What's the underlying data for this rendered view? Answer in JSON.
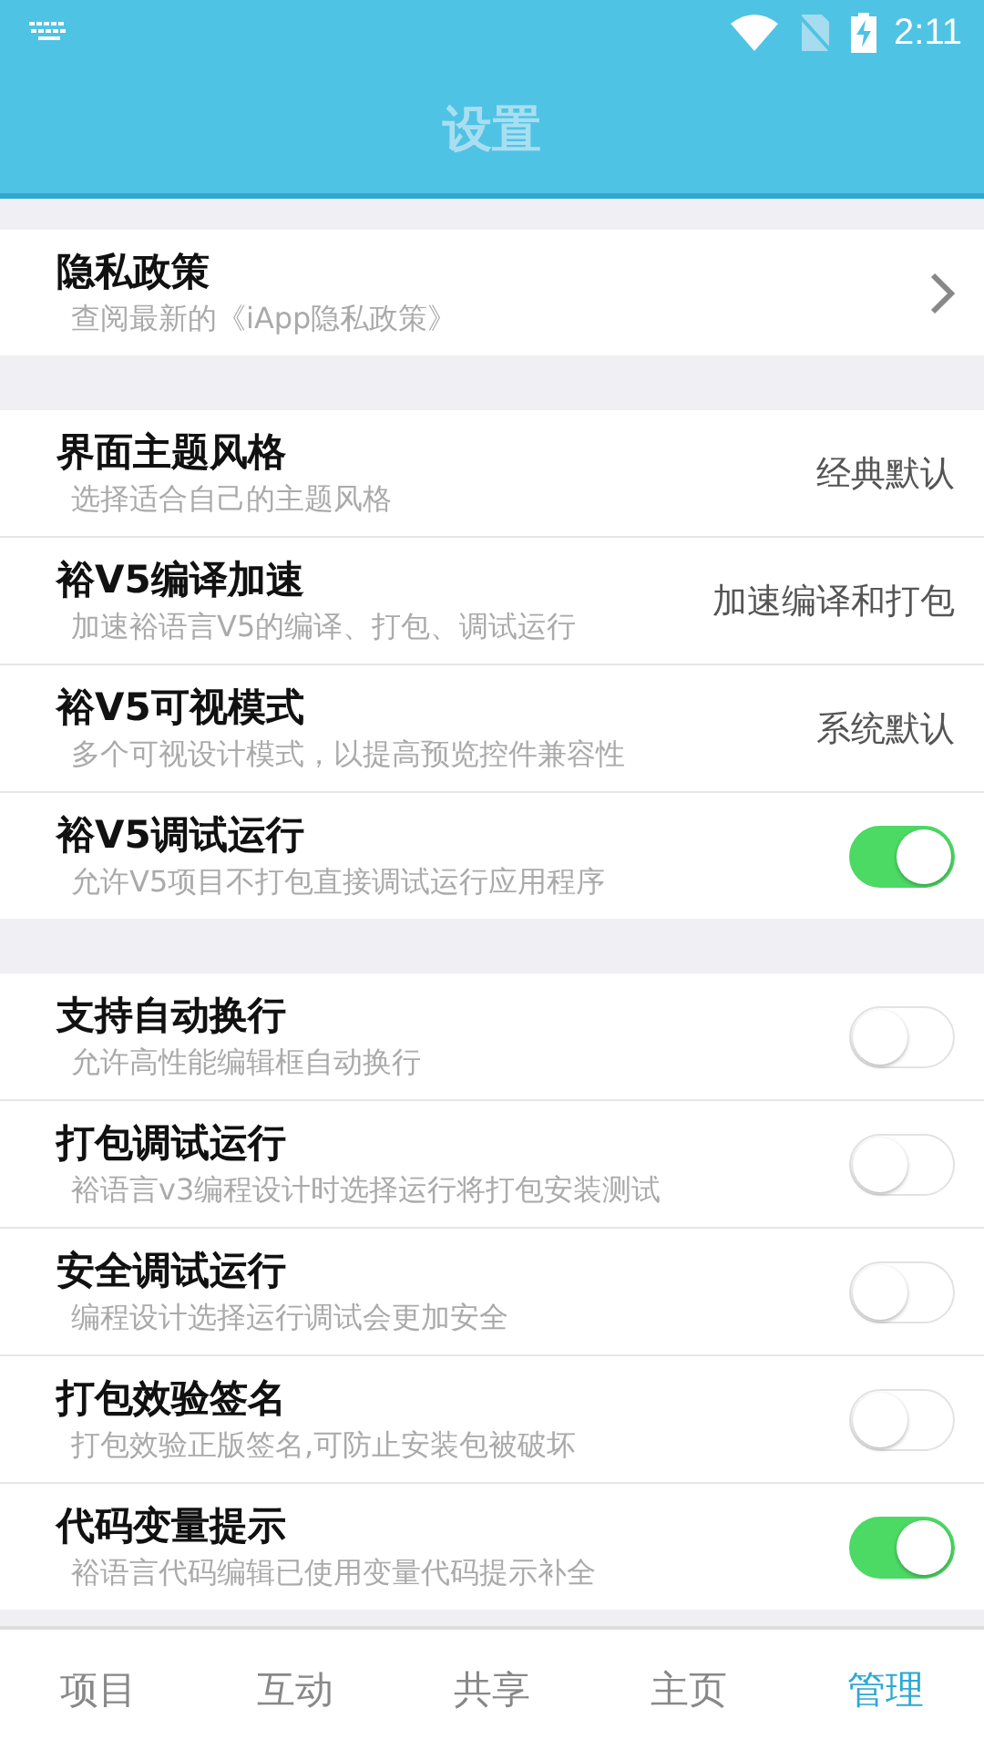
{
  "status_bar": {
    "time": "2:11"
  },
  "app_bar": {
    "title": "设置"
  },
  "sections": [
    {
      "items": [
        {
          "kind": "link",
          "title": "隐私政策",
          "subtitle": "查阅最新的《iApp隐私政策》"
        }
      ]
    },
    {
      "items": [
        {
          "kind": "value",
          "title": "界面主题风格",
          "subtitle": "选择适合自己的主题风格",
          "value": "经典默认"
        },
        {
          "kind": "value",
          "title": "裕V5编译加速",
          "subtitle": "加速裕语言V5的编译、打包、调试运行",
          "value": "加速编译和打包"
        },
        {
          "kind": "value",
          "title": "裕V5可视模式",
          "subtitle": "多个可视设计模式，以提高预览控件兼容性",
          "value": "系统默认"
        },
        {
          "kind": "toggle",
          "title": "裕V5调试运行",
          "subtitle": "允许V5项目不打包直接调试运行应用程序",
          "on": true
        }
      ]
    },
    {
      "items": [
        {
          "kind": "toggle",
          "title": "支持自动换行",
          "subtitle": "允许高性能编辑框自动换行",
          "on": false
        },
        {
          "kind": "toggle",
          "title": "打包调试运行",
          "subtitle": "裕语言v3编程设计时选择运行将打包安装测试",
          "on": false
        },
        {
          "kind": "toggle",
          "title": "安全调试运行",
          "subtitle": "编程设计选择运行调试会更加安全",
          "on": false
        },
        {
          "kind": "toggle",
          "title": "打包效验签名",
          "subtitle": "打包效验正版签名,可防止安装包被破坏",
          "on": false
        },
        {
          "kind": "toggle",
          "title": "代码变量提示",
          "subtitle": "裕语言代码编辑已使用变量代码提示补全",
          "on": true
        }
      ]
    }
  ],
  "bottom_nav": [
    {
      "label": "项目",
      "selected": false
    },
    {
      "label": "互动",
      "selected": false
    },
    {
      "label": "共享",
      "selected": false
    },
    {
      "label": "主页",
      "selected": false
    },
    {
      "label": "管理",
      "selected": true
    }
  ]
}
